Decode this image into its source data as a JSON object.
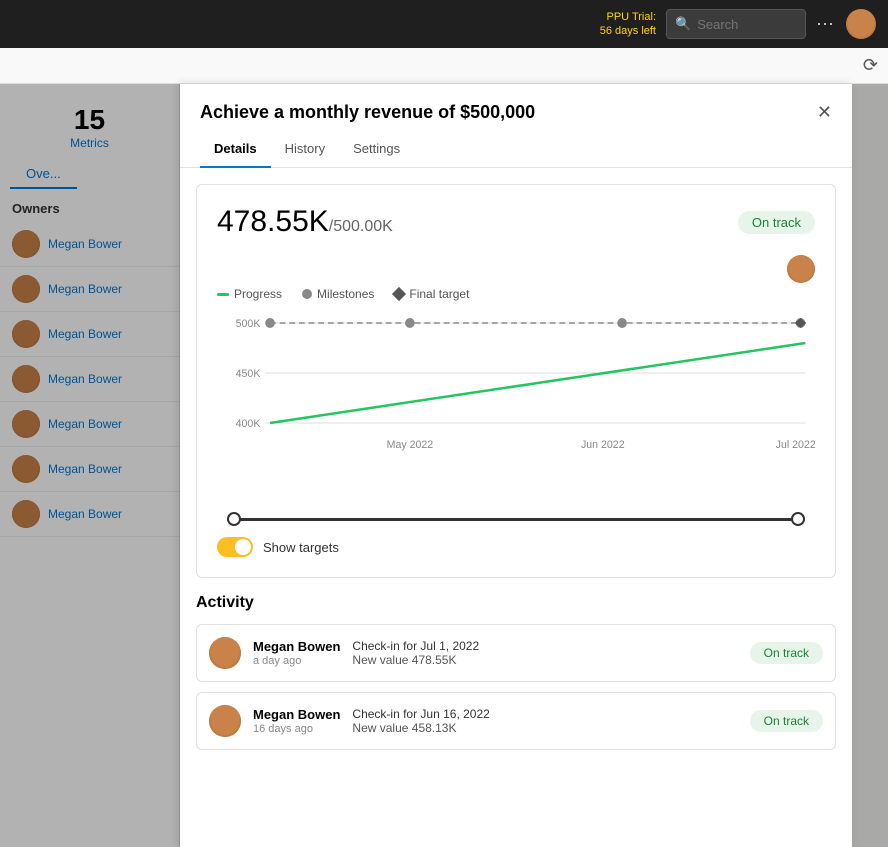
{
  "topnav": {
    "ppu_line1": "PPU Trial:",
    "ppu_line2": "56 days left",
    "search_placeholder": "Search",
    "search_label": "Search"
  },
  "left_panel": {
    "metrics_count": "15",
    "metrics_label": "Metrics",
    "overview_tab": "Ove...",
    "owners_heading": "Owners",
    "owners": [
      {
        "name": "Megan Bower"
      },
      {
        "name": "Megan Bower"
      },
      {
        "name": "Megan Bower"
      },
      {
        "name": "Megan Bower"
      },
      {
        "name": "Megan Bower"
      },
      {
        "name": "Megan Bower"
      },
      {
        "name": "Megan Bower"
      }
    ]
  },
  "modal": {
    "title": "Achieve a monthly revenue of $500,000",
    "tabs": [
      {
        "label": "Details",
        "active": true
      },
      {
        "label": "History",
        "active": false
      },
      {
        "label": "Settings",
        "active": false
      }
    ],
    "chart": {
      "current_value": "478.55K",
      "target_value": "/500.00K",
      "status_badge": "On track",
      "legend": {
        "progress": "Progress",
        "milestones": "Milestones",
        "final_target": "Final target"
      },
      "y_labels": [
        "500K",
        "450K",
        "400K"
      ],
      "x_labels": [
        "May 2022",
        "Jun 2022",
        "Jul 2022"
      ],
      "show_targets_label": "Show targets"
    },
    "activity": {
      "title": "Activity",
      "items": [
        {
          "user": "Megan Bowen",
          "time": "a day ago",
          "checkin": "Check-in for Jul 1, 2022",
          "new_value": "New value 478.55K",
          "badge": "On track"
        },
        {
          "user": "Megan Bowen",
          "time": "16 days ago",
          "checkin": "Check-in for Jun 16, 2022",
          "new_value": "New value 458.13K",
          "badge": "On track"
        }
      ]
    }
  }
}
